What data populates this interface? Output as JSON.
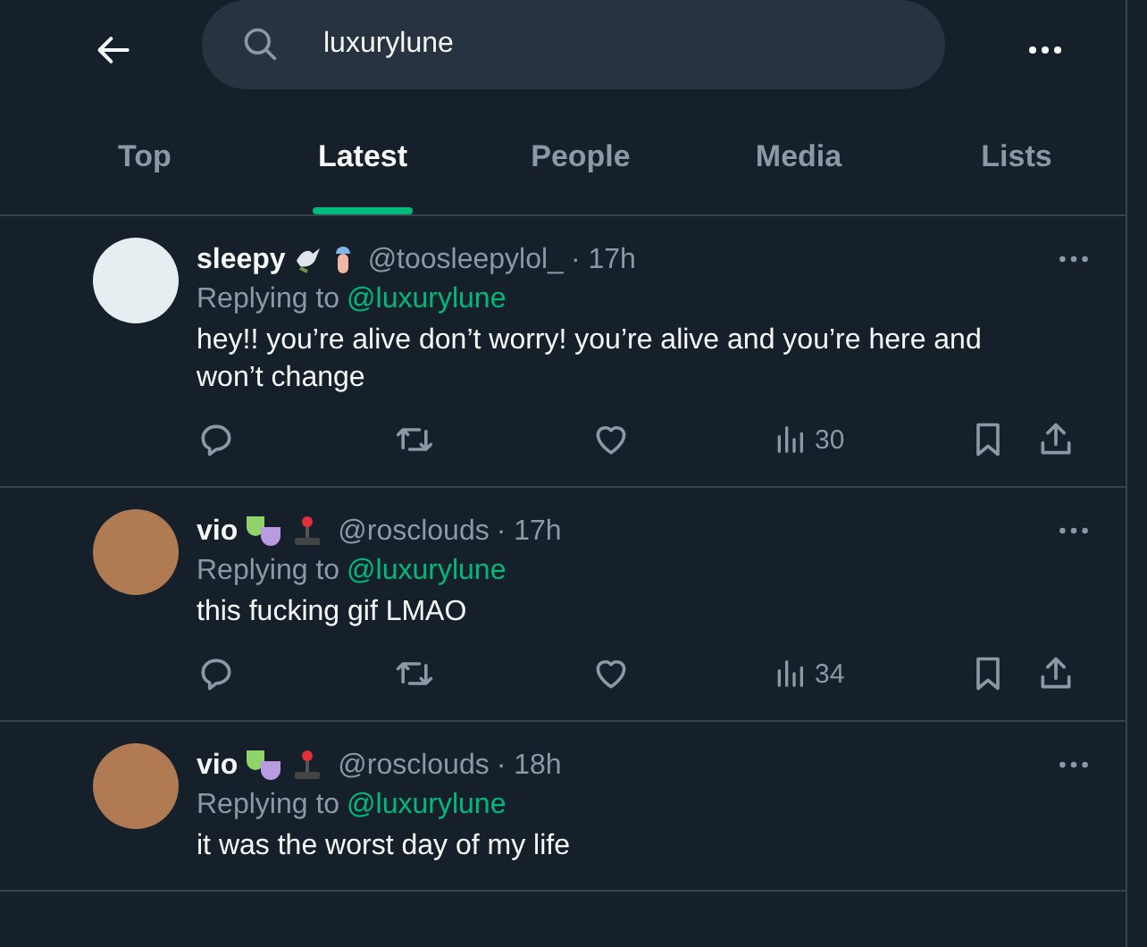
{
  "search": {
    "value": "luxurylune"
  },
  "tabs": [
    {
      "label": "Top",
      "selected": false
    },
    {
      "label": "Latest",
      "selected": true
    },
    {
      "label": "People",
      "selected": false
    },
    {
      "label": "Media",
      "selected": false
    },
    {
      "label": "Lists",
      "selected": false
    }
  ],
  "tweets": [
    {
      "name": "sleepy",
      "emojis": [
        {
          "kind": "dove"
        },
        {
          "kind": "jellyfish"
        }
      ],
      "handle": "@toosleepylol_",
      "time": "· 17h",
      "reply_prefix": "Replying to",
      "reply_to": "@luxurylune",
      "text": "hey!! you’re alive don’t worry! you’re alive and you’re here and won’t change",
      "views": "30",
      "avatar": {
        "color": "#e7eef2"
      }
    },
    {
      "name": "vio",
      "emojis": [
        {
          "kind": "masks"
        },
        {
          "kind": "joystick"
        }
      ],
      "handle": "@rosclouds",
      "time": "· 17h",
      "reply_prefix": "Replying to",
      "reply_to": "@luxurylune",
      "text": "this fucking gif LMAO",
      "views": "34",
      "avatar": {
        "color": "#b07a52"
      }
    },
    {
      "name": "vio",
      "emojis": [
        {
          "kind": "masks"
        },
        {
          "kind": "joystick"
        }
      ],
      "handle": "@rosclouds",
      "time": "· 18h",
      "reply_prefix": "Replying to",
      "reply_to": "@luxurylune",
      "text": "it was the worst day of my life",
      "avatar": {
        "color": "#b07a52"
      }
    }
  ]
}
